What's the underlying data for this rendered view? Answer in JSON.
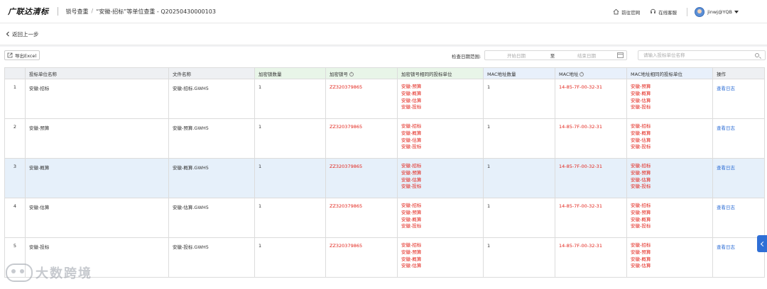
{
  "header": {
    "logo": "广联达清标",
    "breadcrumb_root": "锁号查重",
    "breadcrumb_sep": "/",
    "breadcrumb_current": "“安徽-招标”等单位查重 - Q20250430000103",
    "official_site": "前往官网",
    "support": "在线客服",
    "user": "jinwj@YQB"
  },
  "backbar": {
    "label": "返回上一步"
  },
  "toolbar": {
    "export_label": "导出Excel",
    "date_label": "检查日期范围:",
    "start_placeholder": "开始日期",
    "to": "至",
    "end_placeholder": "结束日期",
    "search_placeholder": "请输入投标单位名称"
  },
  "table": {
    "headers": [
      "",
      "投标单位名称",
      "文件名称",
      "加密锁数量",
      "加密锁号",
      "加密锁号相同的投标单位",
      "MAC地址数量",
      "MAC地址",
      "MAC地址相同的投标单位",
      "操作"
    ],
    "rows": [
      {
        "idx": "1",
        "unit": "安徽-招标",
        "file": "安徽-招标.GWH5",
        "lock_count": "1",
        "lock_no": "ZZ320379865",
        "same_lock": [
          "安徽-预算",
          "安徽-概算",
          "安徽-估算",
          "安徽-投标"
        ],
        "mac_count": "1",
        "mac": "14-85-7F-00-32-31",
        "same_mac": [
          "安徽-预算",
          "安徽-概算",
          "安徽-估算",
          "安徽-投标"
        ],
        "action": "查看日志"
      },
      {
        "idx": "2",
        "unit": "安徽-预算",
        "file": "安徽-预算.GWH5",
        "lock_count": "1",
        "lock_no": "ZZ320379865",
        "same_lock": [
          "安徽-招标",
          "安徽-概算",
          "安徽-估算",
          "安徽-投标"
        ],
        "mac_count": "1",
        "mac": "14-85-7F-00-32-31",
        "same_mac": [
          "安徽-招标",
          "安徽-概算",
          "安徽-估算",
          "安徽-投标"
        ],
        "action": "查看日志"
      },
      {
        "idx": "3",
        "unit": "安徽-概算",
        "file": "安徽-概算.GWH5",
        "lock_count": "1",
        "lock_no": "ZZ320379865",
        "same_lock": [
          "安徽-招标",
          "安徽-预算",
          "安徽-估算",
          "安徽-投标"
        ],
        "mac_count": "1",
        "mac": "14-85-7F-00-32-31",
        "same_mac": [
          "安徽-招标",
          "安徽-预算",
          "安徽-估算",
          "安徽-投标"
        ],
        "action": "查看日志"
      },
      {
        "idx": "4",
        "unit": "安徽-估算",
        "file": "安徽-估算.GWH5",
        "lock_count": "1",
        "lock_no": "ZZ320379865",
        "same_lock": [
          "安徽-招标",
          "安徽-预算",
          "安徽-概算",
          "安徽-投标"
        ],
        "mac_count": "1",
        "mac": "14-85-7F-00-32-31",
        "same_mac": [
          "安徽-招标",
          "安徽-预算",
          "安徽-概算",
          "安徽-投标"
        ],
        "action": "查看日志"
      },
      {
        "idx": "5",
        "unit": "安徽-投标",
        "file": "安徽-投标.GWH5",
        "lock_count": "1",
        "lock_no": "ZZ320379865",
        "same_lock": [
          "安徽-招标",
          "安徽-预算",
          "安徽-概算",
          "安徽-估算"
        ],
        "mac_count": "1",
        "mac": "14-85-7F-00-32-31",
        "same_mac": [
          "安徽-招标",
          "安徽-预算",
          "安徽-概算",
          "安徽-估算"
        ],
        "action": "查看日志"
      }
    ]
  },
  "watermark": {
    "text": "大数跨境"
  },
  "colors": {
    "accent": "#2f6fd6",
    "danger": "#e2231a",
    "highlight_row": "#e6f0fa"
  }
}
